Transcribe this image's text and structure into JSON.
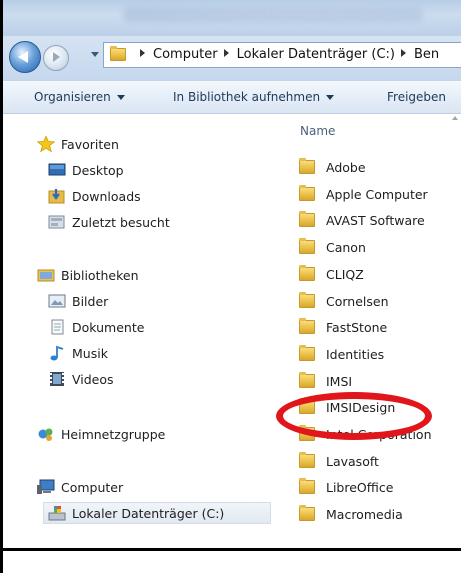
{
  "address": {
    "crumbs": [
      "Computer",
      "Lokaler Datenträger (C:)",
      "Ben"
    ]
  },
  "toolbar": {
    "organize_label": "Organisieren",
    "library_label": "In Bibliothek aufnehmen",
    "share_label": "Freigeben"
  },
  "nav": {
    "favorites_header": "Favoriten",
    "favorites": [
      "Desktop",
      "Downloads",
      "Zuletzt besucht"
    ],
    "libraries_header": "Bibliotheken",
    "libraries": [
      "Bilder",
      "Dokumente",
      "Musik",
      "Videos"
    ],
    "homegroup": "Heimnetzgruppe",
    "computer_header": "Computer",
    "computer_items": [
      "Lokaler Datenträger (C:)"
    ]
  },
  "content": {
    "column_header": "Name",
    "files": [
      "Adobe",
      "Apple Computer",
      "AVAST Software",
      "Canon",
      "CLIQZ",
      "Cornelsen",
      "FastStone",
      "Identities",
      "IMSI",
      "IMSIDesign",
      "Intel Corporation",
      "Lavasoft",
      "LibreOffice",
      "Macromedia"
    ]
  },
  "colors": {
    "annotation": "#e1161a",
    "toolbar_text": "#1e395b"
  },
  "icons": {
    "back": "back-arrow-icon",
    "forward": "forward-arrow-icon",
    "folder": "folder-icon",
    "star": "star-icon"
  }
}
